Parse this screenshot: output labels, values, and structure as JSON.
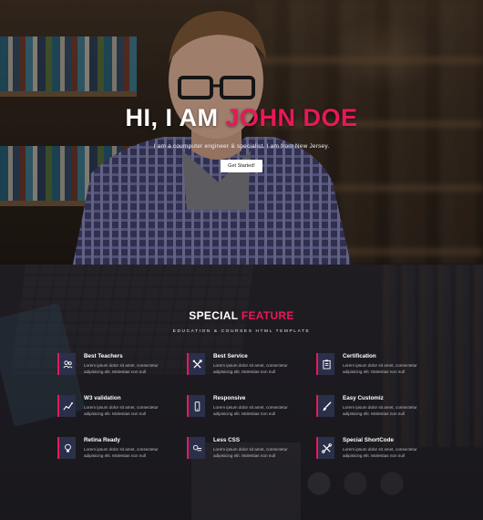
{
  "hero": {
    "title_prefix": "HI, I AM ",
    "title_name": "JOHN DOE",
    "subtitle": "I am a coumputer engineer & specialist. I am from New Jersey.",
    "button_label": "Get Started!"
  },
  "feature": {
    "title_prefix": "SPECIAL ",
    "title_accent": "FEATURE",
    "subtitle": "EDUCATION & COURSES HTML TEMPLATE",
    "items": [
      {
        "title": "Best Teachers",
        "text": "Lorem ipsum dolor sit amet, consectetur adipisicing elit. Molestias non null",
        "icon": "people-icon"
      },
      {
        "title": "Best Service",
        "text": "Lorem ipsum dolor sit amet, consectetur adipisicing elit. Molestias non null",
        "icon": "tools-icon"
      },
      {
        "title": "Certification",
        "text": "Lorem ipsum dolor sit amet, consectetur adipisicing elit. Molestias non null",
        "icon": "certificate-icon"
      },
      {
        "title": "W3 validation",
        "text": "Lorem ipsum dolor sit amet, consectetur adipisicing elit. Molestias non null",
        "icon": "chart-icon"
      },
      {
        "title": "Responsive",
        "text": "Lorem ipsum dolor sit amet, consectetur adipisicing elit. Molestias non null",
        "icon": "mobile-icon"
      },
      {
        "title": "Easy Customiz",
        "text": "Lorem ipsum dolor sit amet, consectetur adipisicing elit. Molestias non null",
        "icon": "brush-icon"
      },
      {
        "title": "Retina Ready",
        "text": "Lorem ipsum dolor sit amet, consectetur adipisicing elit. Molestias non null",
        "icon": "bulb-icon"
      },
      {
        "title": "Less CSS",
        "text": "Lorem ipsum dolor sit amet, consectetur adipisicing elit. Molestias non null",
        "icon": "code-icon"
      },
      {
        "title": "Special ShortCode",
        "text": "Lorem ipsum dolor sit amet, consectetur adipisicing elit. Molestias non null",
        "icon": "wrench-icon"
      }
    ]
  },
  "colors": {
    "accent": "#e8185a",
    "icon_bg": "#2a2f4a"
  }
}
